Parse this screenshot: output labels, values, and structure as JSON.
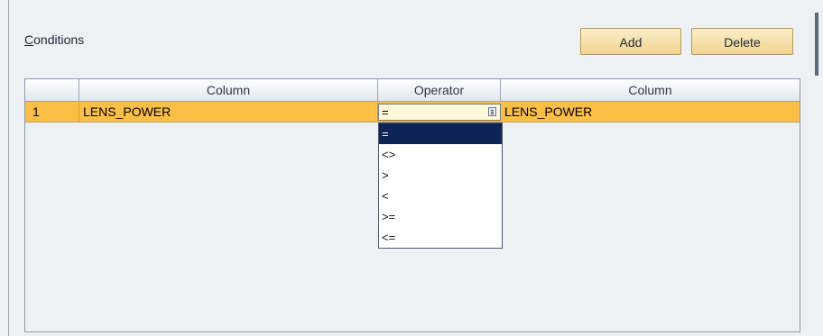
{
  "conditions": {
    "title": "Conditions",
    "title_accelerator": "C",
    "title_rest": "onditions",
    "add_label": "Add",
    "delete_label": "Delete"
  },
  "table": {
    "headers": {
      "selector": "",
      "column_left": "Column",
      "operator": "Operator",
      "column_right": "Column"
    },
    "rows": [
      {
        "number": "1",
        "column_left": "LENS_POWER",
        "operator": "=",
        "column_right": "LENS_POWER"
      }
    ]
  },
  "operator_dropdown": {
    "selected": "=",
    "options": [
      "=",
      "<>",
      ">",
      "<",
      ">=",
      "<="
    ]
  },
  "colors": {
    "selected_row": "#fbbf45",
    "selected_option": "#0e2357",
    "button": "#f1d592"
  }
}
